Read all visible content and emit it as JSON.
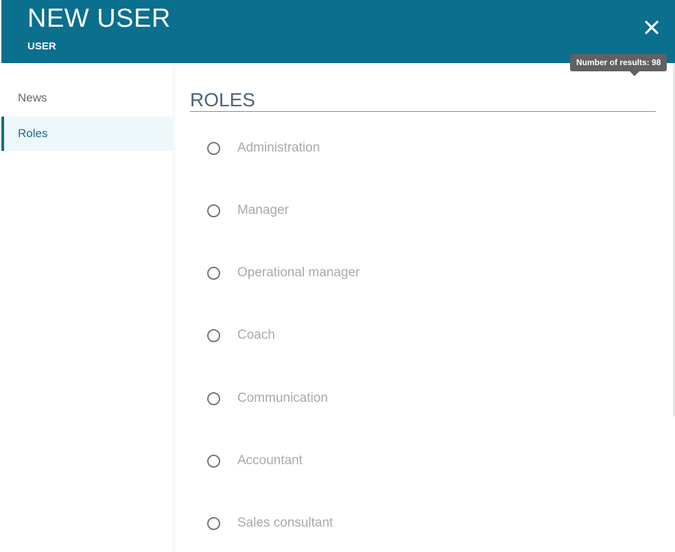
{
  "header": {
    "title": "NEW USER",
    "subtitle": "USER",
    "close_icon": "close-icon"
  },
  "tooltip": {
    "text": "Number of results: 98"
  },
  "sidebar": {
    "items": [
      {
        "label": "News",
        "active": false
      },
      {
        "label": "Roles",
        "active": true
      }
    ]
  },
  "roles": {
    "title": "ROLES",
    "options": [
      {
        "label": "Administration",
        "selected": false
      },
      {
        "label": "Manager",
        "selected": false
      },
      {
        "label": "Operational manager",
        "selected": false
      },
      {
        "label": "Coach",
        "selected": false
      },
      {
        "label": "Communication",
        "selected": false
      },
      {
        "label": "Accountant",
        "selected": false
      },
      {
        "label": "Sales consultant",
        "selected": false
      }
    ]
  },
  "colors": {
    "header_bg": "#0b6f8e",
    "active_item_bg": "#eef8fa",
    "tooltip_bg": "#616161",
    "option_text": "#a9a9a9"
  }
}
